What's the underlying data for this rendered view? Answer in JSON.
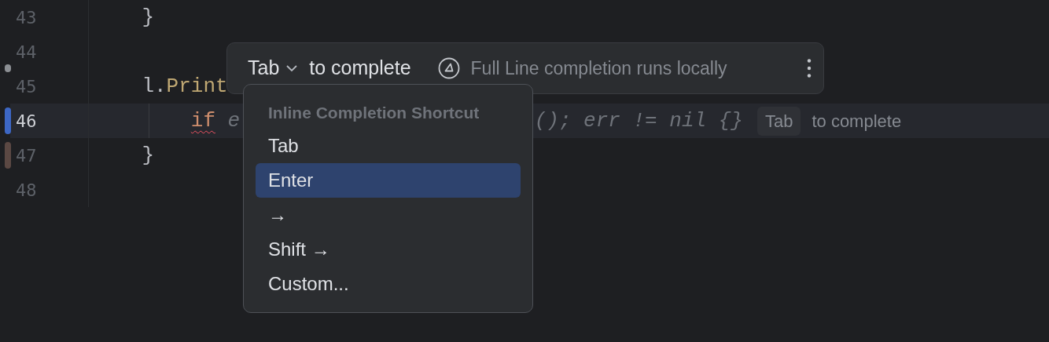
{
  "editor": {
    "lines": [
      {
        "number": "43",
        "current": false,
        "marker": false,
        "tokens": [
          {
            "text": "}",
            "kind": "plain",
            "error": false
          }
        ]
      },
      {
        "number": "44",
        "current": false,
        "marker": true
      },
      {
        "number": "45",
        "current": false,
        "marker": false,
        "tokens": [
          {
            "text": "l.",
            "kind": "plain",
            "error": false
          },
          {
            "text": "Print",
            "kind": "function",
            "error": false
          }
        ],
        "children": [
          {
            "number": "46",
            "current": true,
            "marker": false,
            "change_marker": {
              "color": "#3d67c4"
            },
            "tokens": [
              {
                "text": "if",
                "kind": "keyword",
                "error": true
              },
              {
                "text": " e",
                "kind": "ghost",
                "error": false
              }
            ],
            "ghost_continuation": "(); err != nil {}",
            "hint": {
              "key": "Tab",
              "text": "to complete"
            }
          }
        ]
      },
      {
        "number": "47",
        "current": false,
        "marker": false,
        "change_marker": {
          "color": "#5b4843"
        },
        "tokens": [
          {
            "text": "}",
            "kind": "plain",
            "error": false
          }
        ]
      },
      {
        "number": "48",
        "current": false,
        "marker": false
      }
    ]
  },
  "completion_popup": {
    "shortcut_button": "Tab",
    "label": "to complete",
    "info": "Full Line completion runs locally"
  },
  "shortcut_menu": {
    "header": "Inline Completion Shortcut",
    "items": [
      {
        "label": "Tab",
        "selected": false
      },
      {
        "label": "Enter",
        "selected": true
      },
      {
        "label": "→",
        "selected": false
      },
      {
        "label": "Shift →",
        "selected": false
      },
      {
        "label": "Custom...",
        "selected": false
      }
    ]
  }
}
